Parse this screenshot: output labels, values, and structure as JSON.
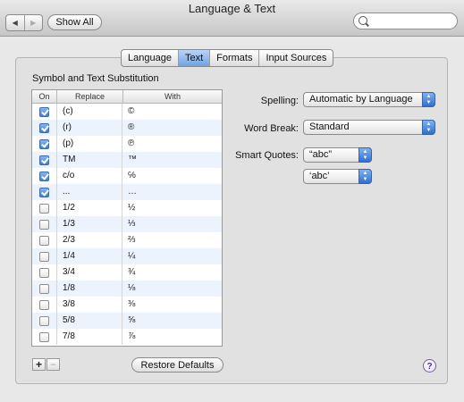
{
  "window": {
    "title": "Language & Text"
  },
  "toolbar": {
    "back_glyph": "◀",
    "forward_glyph": "▶",
    "show_all_label": "Show All",
    "search": {
      "value": "",
      "placeholder": ""
    }
  },
  "tabs": [
    {
      "label": "Language",
      "selected": false
    },
    {
      "label": "Text",
      "selected": true
    },
    {
      "label": "Formats",
      "selected": false
    },
    {
      "label": "Input Sources",
      "selected": false
    }
  ],
  "substitution": {
    "title": "Symbol and Text Substitution",
    "columns": {
      "on": "On",
      "replace": "Replace",
      "with": "With"
    },
    "rows": [
      {
        "on": true,
        "replace": "(c)",
        "with": "©"
      },
      {
        "on": true,
        "replace": "(r)",
        "with": "®"
      },
      {
        "on": true,
        "replace": "(p)",
        "with": "℗"
      },
      {
        "on": true,
        "replace": "TM",
        "with": "™"
      },
      {
        "on": true,
        "replace": "c/o",
        "with": "℅"
      },
      {
        "on": true,
        "replace": "...",
        "with": "…"
      },
      {
        "on": false,
        "replace": "1/2",
        "with": "½"
      },
      {
        "on": false,
        "replace": "1/3",
        "with": "⅓"
      },
      {
        "on": false,
        "replace": "2/3",
        "with": "⅔"
      },
      {
        "on": false,
        "replace": "1/4",
        "with": "¼"
      },
      {
        "on": false,
        "replace": "3/4",
        "with": "¾"
      },
      {
        "on": false,
        "replace": "1/8",
        "with": "⅛"
      },
      {
        "on": false,
        "replace": "3/8",
        "with": "⅜"
      },
      {
        "on": false,
        "replace": "5/8",
        "with": "⅝"
      },
      {
        "on": false,
        "replace": "7/8",
        "with": "⅞"
      }
    ],
    "add_label": "+",
    "remove_label": "−",
    "restore_label": "Restore Defaults"
  },
  "settings": {
    "spelling": {
      "label": "Spelling:",
      "value": "Automatic by Language"
    },
    "word_break": {
      "label": "Word Break:",
      "value": "Standard"
    },
    "smart_quotes": {
      "label": "Smart Quotes:",
      "double_value": "“abc”",
      "single_value": "‘abc’"
    }
  },
  "help_label": "?",
  "colors": {
    "selected_tab": "#6fa3e4",
    "checkbox_on": "#3f7fd6",
    "row_stripe": "#edf3fd"
  },
  "icons": {
    "back": "back-arrow-icon",
    "forward": "forward-arrow-icon",
    "search": "search-icon",
    "help": "help-icon"
  }
}
